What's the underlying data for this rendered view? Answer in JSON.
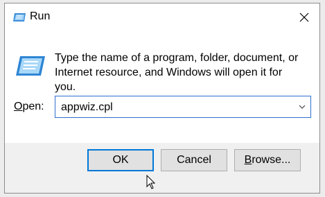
{
  "window": {
    "title": "Run",
    "title_icon": "run-icon",
    "close_icon": "close-icon"
  },
  "content": {
    "description": "Type the name of a program, folder, document, or Internet resource, and Windows will open it for you.",
    "icon": "run-large-icon"
  },
  "open_field": {
    "label_first": "O",
    "label_rest": "pen:",
    "value": "appwiz.cpl",
    "dropdown_icon": "chevron-down-icon"
  },
  "buttons": {
    "ok": "OK",
    "cancel": "Cancel",
    "browse_first": "B",
    "browse_rest": "rowse..."
  },
  "colors": {
    "accent": "#0078d7",
    "button_bg": "#e1e1e1",
    "footer_bg": "#f0f0f0"
  }
}
